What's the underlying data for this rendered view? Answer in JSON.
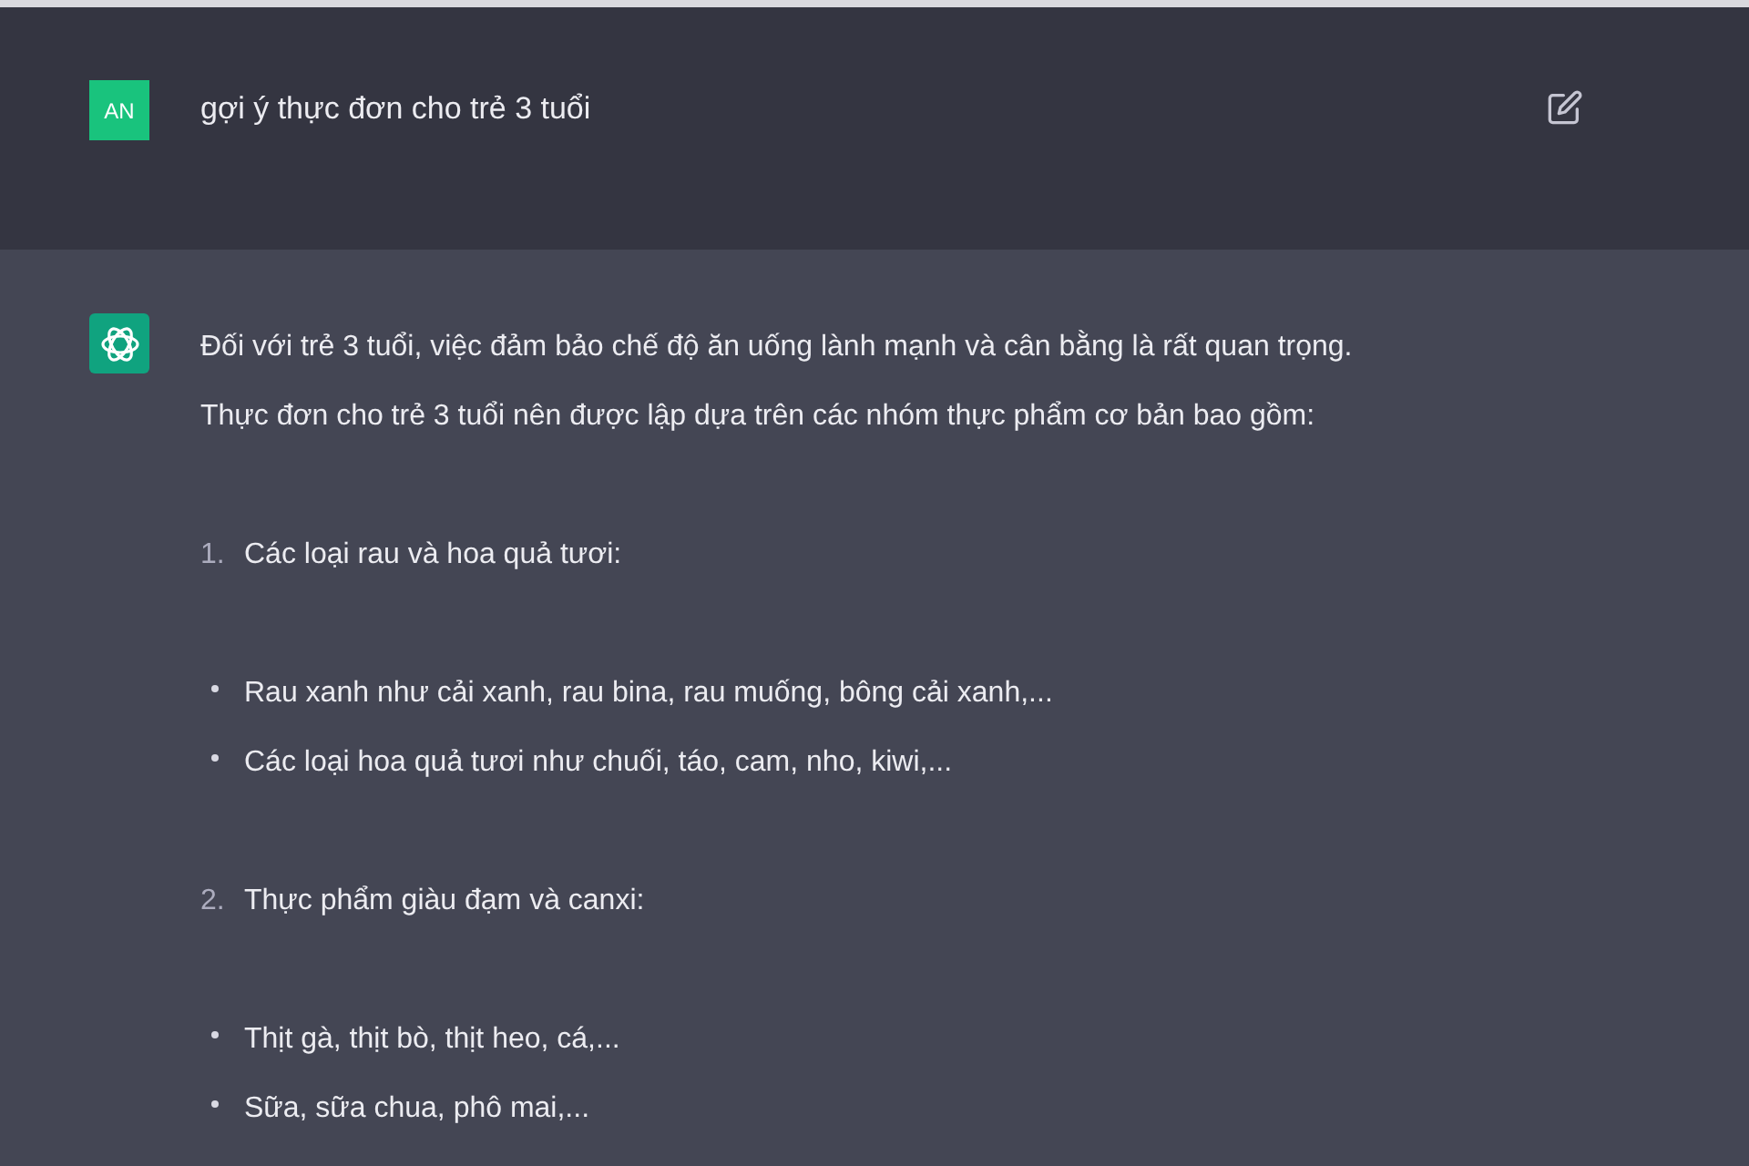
{
  "user_message": {
    "avatar": "AN",
    "text": "gợi ý thực đơn cho trẻ 3 tuổi"
  },
  "assistant_message": {
    "paragraphs": [
      "Đối với trẻ 3 tuổi, việc đảm bảo chế độ ăn uống lành mạnh và cân bằng là rất quan trọng.",
      "Thực đơn cho trẻ 3 tuổi nên được lập dựa trên các nhóm thực phẩm cơ bản bao gồm:"
    ],
    "list": [
      {
        "number": "1.",
        "title": "Các loại rau và hoa quả tươi:",
        "bullets": [
          "Rau xanh như cải xanh, rau bina, rau muống, bông cải xanh,...",
          "Các loại hoa quả tươi như chuối, táo, cam, nho, kiwi,..."
        ]
      },
      {
        "number": "2.",
        "title": "Thực phẩm giàu đạm và canxi:",
        "bullets": [
          "Thịt gà, thịt bò, thịt heo, cá,...",
          "Sữa, sữa chua, phô mai,..."
        ]
      }
    ]
  }
}
